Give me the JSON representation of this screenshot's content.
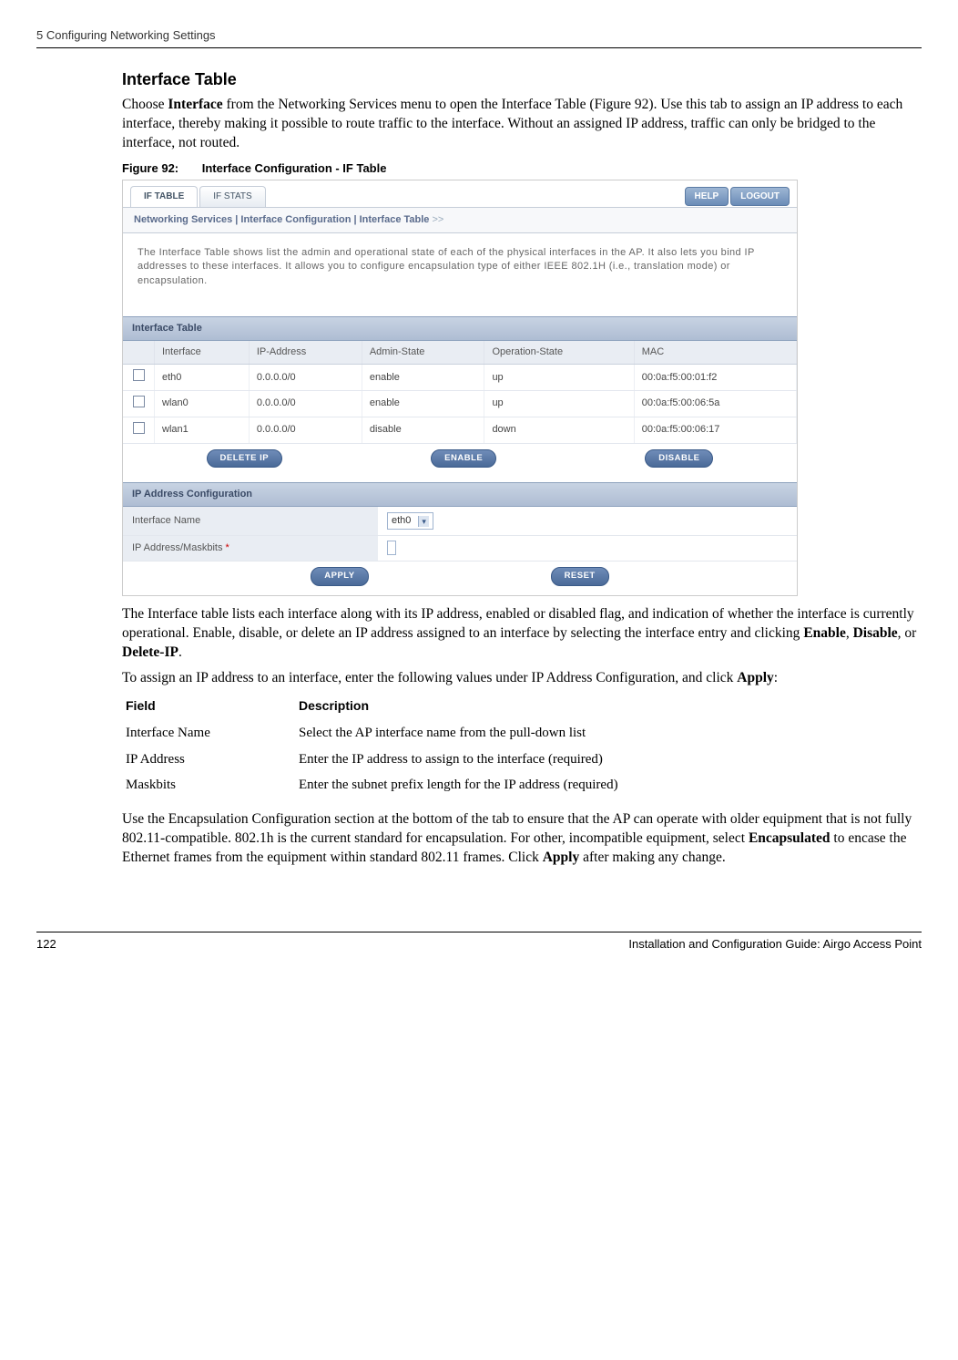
{
  "header": {
    "chapter": "5  Configuring Networking Settings"
  },
  "section": {
    "title": "Interface Table",
    "intro_pre": "Choose ",
    "intro_bold1": "Interface",
    "intro_post": " from the Networking Services menu to open the Interface Table (Figure 92). Use this tab to assign an IP address to each interface, thereby making it possible to route traffic to the interface. Without an assigned IP address, traffic can only be bridged to the interface, not routed."
  },
  "figure": {
    "label": "Figure 92:",
    "title": "Interface Configuration - IF Table",
    "tabs": {
      "tab1": "IF TABLE",
      "tab2": "IF STATS"
    },
    "buttons": {
      "help": "HELP",
      "logout": "LOGOUT"
    },
    "breadcrumb": "Networking Services | Interface Configuration | Interface Table",
    "crumb_arrow": " >>",
    "desc": "The Interface Table shows list the admin and operational state of each of the physical interfaces in the AP. It also lets you bind IP addresses to these interfaces. It allows you to configure encapsulation type of either IEEE 802.1H (i.e., translation mode) or encapsulation.",
    "block1_title": "Interface Table",
    "th": {
      "iface": "Interface",
      "ip": "IP-Address",
      "admin": "Admin-State",
      "op": "Operation-State",
      "mac": "MAC"
    },
    "rows": [
      {
        "iface": "eth0",
        "ip": "0.0.0.0/0",
        "admin": "enable",
        "op": "up",
        "mac": "00:0a:f5:00:01:f2"
      },
      {
        "iface": "wlan0",
        "ip": "0.0.0.0/0",
        "admin": "enable",
        "op": "up",
        "mac": "00:0a:f5:00:06:5a"
      },
      {
        "iface": "wlan1",
        "ip": "0.0.0.0/0",
        "admin": "disable",
        "op": "down",
        "mac": "00:0a:f5:00:06:17"
      }
    ],
    "actions": {
      "del": "DELETE IP",
      "en": "ENABLE",
      "dis": "DISABLE"
    },
    "block2_title": "IP Address Configuration",
    "ipconf": {
      "label1": "Interface Name",
      "sel_value": "eth0",
      "label2": "IP Address/Maskbits",
      "req": " *"
    },
    "actions2": {
      "apply": "APPLY",
      "reset": "RESET"
    }
  },
  "after_fig": {
    "p1_pre": "The Interface table lists each interface along with its IP address, enabled or disabled flag, and indication of whether the interface is currently operational. Enable, disable, or delete an IP address assigned to an interface by selecting the interface entry and clicking ",
    "p1_b1": "Enable",
    "p1_m1": ", ",
    "p1_b2": "Disable",
    "p1_m2": ", or ",
    "p1_b3": "Delete-IP",
    "p1_end": ".",
    "p2_pre": "To assign an IP address to an interface, enter the following values under IP Address Configuration, and click ",
    "p2_b1": "Apply",
    "p2_end": ":"
  },
  "field_table": {
    "h1": "Field",
    "h2": "Description",
    "rows": [
      {
        "f": "Interface Name",
        "d": "Select the AP interface name from the pull-down list"
      },
      {
        "f": "IP Address",
        "d": "Enter the IP address to assign to the interface (required)"
      },
      {
        "f": "Maskbits",
        "d": "Enter the subnet prefix length for the IP address (required)"
      }
    ]
  },
  "encap": {
    "pre": "Use the Encapsulation Configuration section at the bottom of the tab to ensure that the AP can operate with older equipment that is not fully 802.11-compatible. 802.1h is the current standard for encapsulation. For other, incompatible equipment, select ",
    "b1": "Encapsulated",
    "mid": " to encase the Ethernet frames from the equipment within standard 802.11 frames. Click ",
    "b2": "Apply",
    "end": " after making any change."
  },
  "footer": {
    "page": "122",
    "title": "Installation and Configuration Guide: Airgo Access Point"
  }
}
